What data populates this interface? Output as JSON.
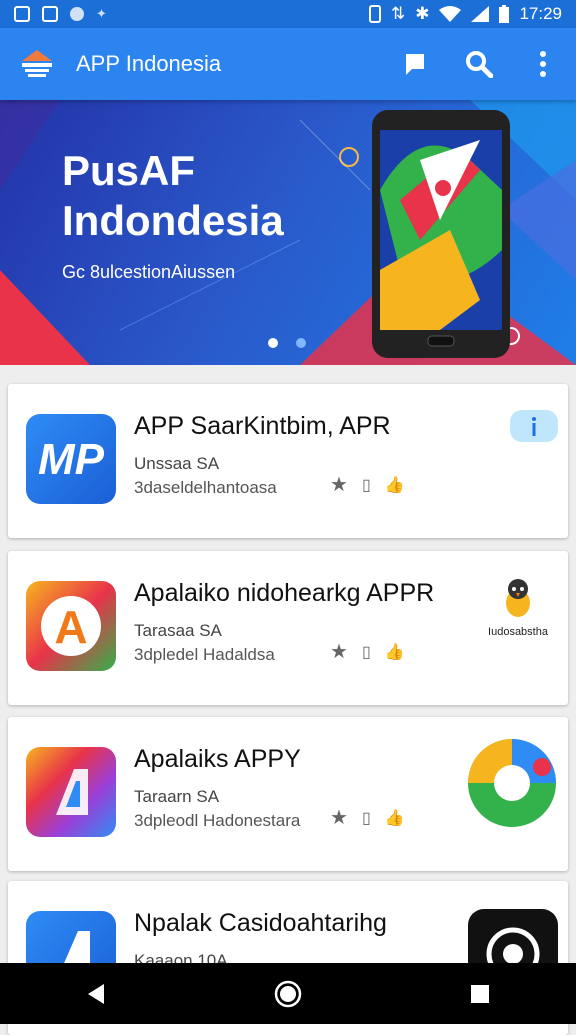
{
  "status_bar": {
    "time": "17:29"
  },
  "appbar": {
    "title": "APP Indonesia"
  },
  "banner": {
    "title_line1": "PusAF",
    "title_line2": "Indondesia",
    "subtitle": "Gc 8ulcestionAiussen",
    "slide_count": 2,
    "active_slide": 1
  },
  "apps": [
    {
      "title": "APP SaarKintbim, APR",
      "developer": "Unssaa  SA",
      "category": "3daseldelhantoasa"
    },
    {
      "title": "Apalaiko nidohearkɡ APPR",
      "developer": "Tarasaa  SA",
      "category": "3dpledel Hadaldsa",
      "badge": "Iudosabstha"
    },
    {
      "title": "Apalaiks APPY",
      "developer": "Taraarn  SA",
      "category": "3dpleodl Hadonestara"
    },
    {
      "title": "Npalak Casidoahtarihg",
      "developer": "Kaaaon  10A",
      "category": ""
    }
  ],
  "colors": {
    "appbar": "#2c84f0",
    "statusbar": "#1d6fd8",
    "accent": "#1e6fe0"
  }
}
